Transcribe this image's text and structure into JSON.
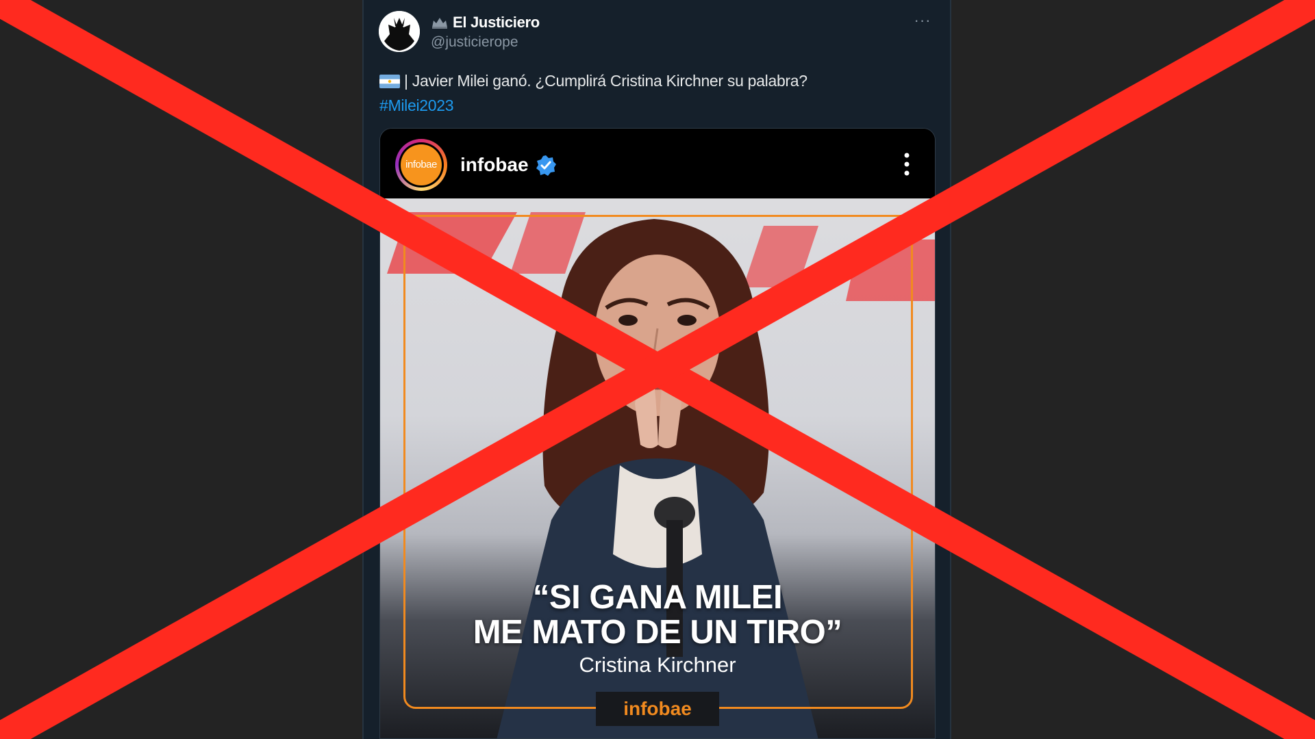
{
  "tweet": {
    "display_name": "El Justiciero",
    "handle": "@justicierope",
    "more_label": "···",
    "text": "| Javier Milei ganó. ¿Cumplirá Cristina Kirchner su palabra?",
    "hashtag": "#Milei2023",
    "flag_icon": "argentina-flag-icon"
  },
  "embedded_post": {
    "account_name": "infobae",
    "avatar_text": "infobae",
    "verified": true,
    "quote_line_1": "“SI GANA MILEI",
    "quote_line_2": "ME MATO DE UN TIRO”",
    "author": "Cristina Kirchner",
    "brand": "infobae"
  },
  "colors": {
    "page_background": "#232323",
    "tweet_background": "#15202b",
    "link": "#1d9bf0",
    "infobae_orange": "#f18a1f",
    "x_overlay_red": "#ff2a1f"
  }
}
